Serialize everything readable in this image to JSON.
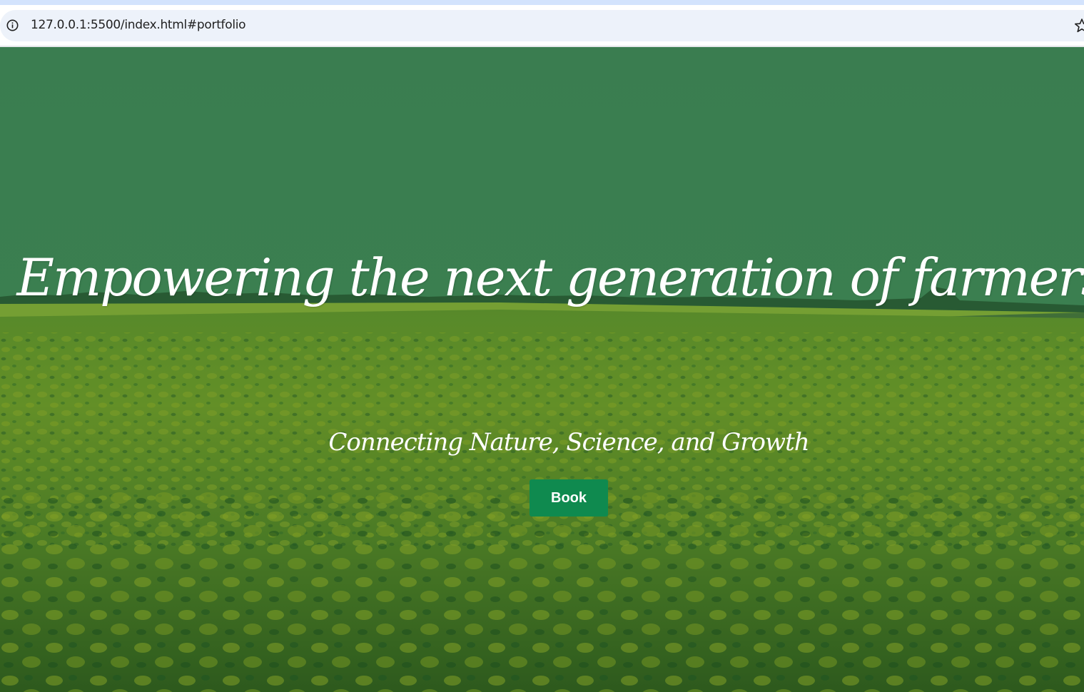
{
  "browser": {
    "url": "127.0.0.1:5500/index.html#portfolio",
    "icons": [
      "info-icon",
      "bookmark-star-icon"
    ]
  },
  "hero": {
    "headline": "Empowering the next generation of farmers.",
    "subtitle": "Connecting Nature, Science, and Growth",
    "button_label": "Book"
  },
  "colors": {
    "overlay_green": "#2e7d4f",
    "button_green": "#0f8a4f",
    "field_yellow_green": "#7a9a1e",
    "text": "#ffffff"
  }
}
